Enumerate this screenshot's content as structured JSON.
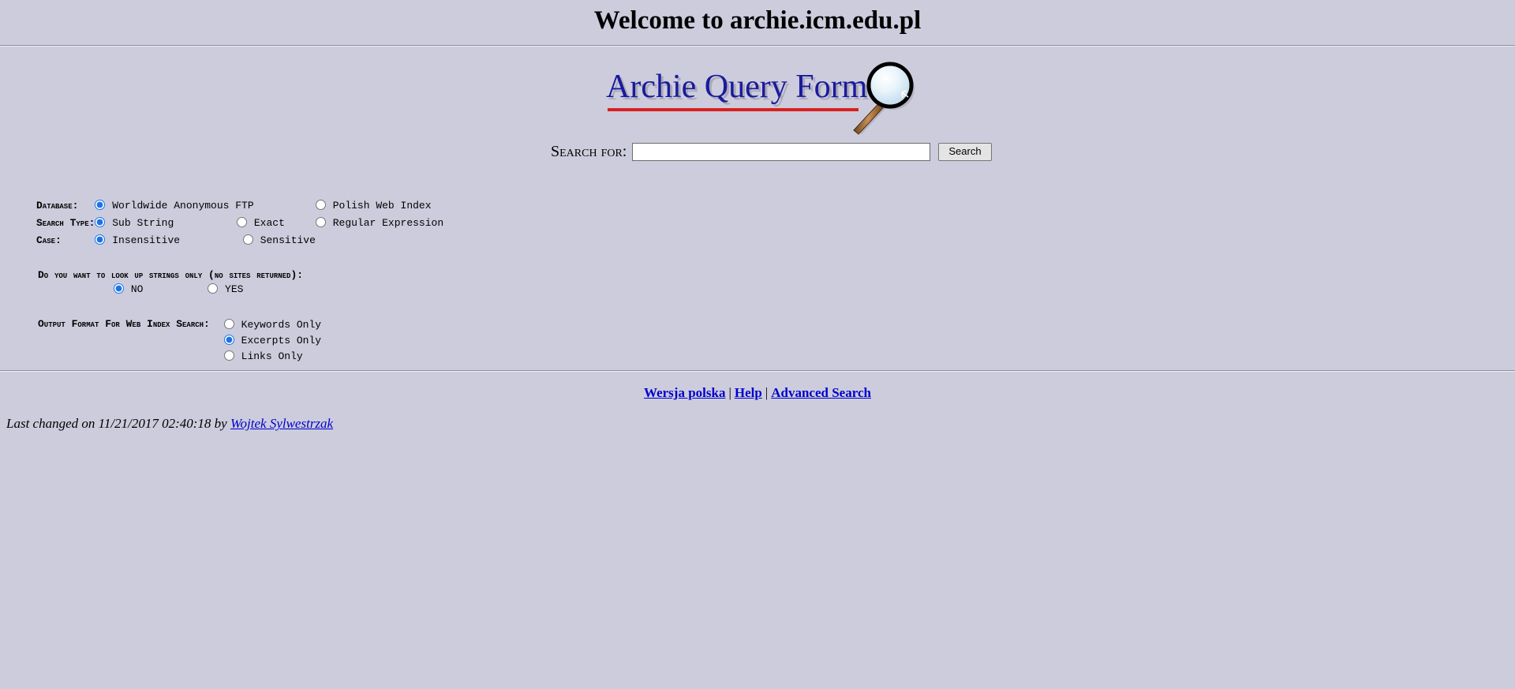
{
  "page": {
    "title": "Welcome to archie.icm.edu.pl",
    "background_color": "#ccccdd"
  },
  "logo": {
    "text": "Archie Query Form",
    "text_color": "#1a1a9c",
    "underline_color": "#d82020",
    "icon": "magnifying-glass-icon"
  },
  "search": {
    "label": "Search for:",
    "value": "",
    "placeholder": "",
    "button_label": "Search"
  },
  "options": {
    "rows": [
      {
        "label": "Database:",
        "choices": [
          {
            "label": "Worldwide Anonymous FTP",
            "checked": true
          },
          {
            "label": "Polish Web Index",
            "checked": false
          }
        ]
      },
      {
        "label": "Search Type:",
        "choices": [
          {
            "label": "Sub String",
            "checked": true
          },
          {
            "label": "Exact",
            "checked": false
          },
          {
            "label": "Regular Expression",
            "checked": false
          }
        ]
      },
      {
        "label": "Case:",
        "choices": [
          {
            "label": "Insensitive",
            "checked": true
          },
          {
            "label": "Sensitive",
            "checked": false
          }
        ]
      }
    ]
  },
  "strings_only": {
    "question": "Do you want to look up strings only (no sites returned):",
    "choices": [
      {
        "label": "NO",
        "checked": true
      },
      {
        "label": "YES",
        "checked": false
      }
    ]
  },
  "output_format": {
    "label": "Output Format For Web Index Search:",
    "choices": [
      {
        "label": "Keywords Only",
        "checked": false
      },
      {
        "label": "Excerpts Only",
        "checked": true
      },
      {
        "label": "Links Only",
        "checked": false
      }
    ]
  },
  "footer": {
    "links": [
      {
        "label": "Wersja polska"
      },
      {
        "label": "Help"
      },
      {
        "label": "Advanced Search"
      }
    ],
    "separator": "|",
    "last_changed_prefix": "Last changed on 11/21/2017 02:40:18 by",
    "last_changed_author": "Wojtek Sylwestrzak",
    "link_color": "#0000cc"
  }
}
